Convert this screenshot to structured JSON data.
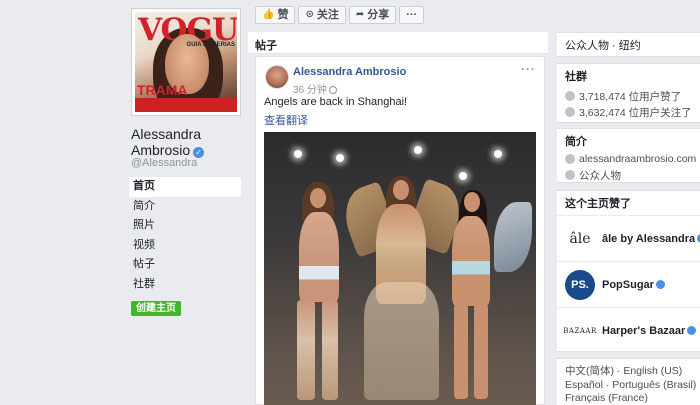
{
  "sidebar": {
    "cover": {
      "magazine": "VOGUE",
      "side_text": "GUIA DE FERIAS",
      "bottom_text": "TRAMA"
    },
    "name": "Alessandra Ambrosio",
    "handle": "@Alessandra",
    "nav": [
      "首页",
      "简介",
      "照片",
      "视频",
      "帖子",
      "社群"
    ],
    "active_nav": "首页",
    "create_page_label": "创建主页"
  },
  "action_bar": {
    "like_label": "赞",
    "follow_label": "关注",
    "share_label": "分享",
    "more_label": "···"
  },
  "posts": {
    "title": "帖子",
    "post": {
      "author": "Alessandra Ambrosio",
      "time": "36 分钟",
      "text": "Angels are back in Shanghai!",
      "translate": "查看翻译",
      "more": "···"
    }
  },
  "right": {
    "category": "公众人物 · 纽约",
    "community": {
      "title": "社群",
      "likes": "3,718,474 位用户赞了",
      "follows": "3,632,474 位用户关注了"
    },
    "about": {
      "title": "简介",
      "website": "alessandraambrosio.com",
      "category": "公众人物"
    },
    "liked_pages": {
      "title": "这个主页赞了",
      "items": [
        {
          "name": "âle by Alessandra",
          "logo": "âle"
        },
        {
          "name": "PopSugar",
          "logo": "PS."
        },
        {
          "name": "Harper's Bazaar",
          "logo": "BAZAAR"
        }
      ]
    },
    "languages": {
      "line1": [
        "中文(简体)",
        "English (US)"
      ],
      "line2": [
        "Español",
        "Português (Brasil)"
      ],
      "line3": [
        "Français (France)"
      ]
    }
  },
  "colors": {
    "link": "#365899",
    "verified": "#4a90e2",
    "create_button": "#42b72a",
    "vogue": "#d2232a"
  }
}
